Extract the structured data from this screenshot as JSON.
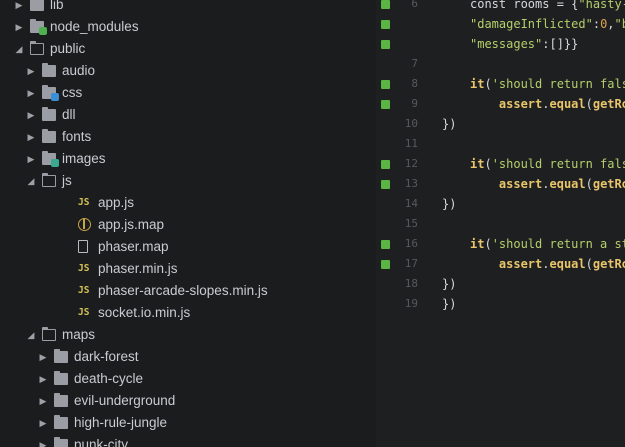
{
  "sidebar": {
    "items": [
      {
        "label": "lib",
        "type": "folder",
        "state": "collapsed",
        "depth": 0
      },
      {
        "label": "node_modules",
        "type": "folder-badged",
        "state": "collapsed",
        "depth": 0,
        "badge_color": "#4fb04f"
      },
      {
        "label": "public",
        "type": "folder",
        "state": "expanded",
        "depth": 0
      },
      {
        "label": "audio",
        "type": "folder",
        "state": "collapsed",
        "depth": 1
      },
      {
        "label": "css",
        "type": "folder-badged",
        "state": "collapsed",
        "depth": 1,
        "badge_color": "#3b8fd6"
      },
      {
        "label": "dll",
        "type": "folder",
        "state": "collapsed",
        "depth": 1
      },
      {
        "label": "fonts",
        "type": "folder",
        "state": "collapsed",
        "depth": 1
      },
      {
        "label": "images",
        "type": "folder-badged",
        "state": "collapsed",
        "depth": 1,
        "badge_color": "#39a98f"
      },
      {
        "label": "js",
        "type": "folder",
        "state": "expanded",
        "depth": 1
      },
      {
        "label": "app.js",
        "type": "js-file",
        "depth": 2,
        "icon_text": "JS"
      },
      {
        "label": "app.js.map",
        "type": "map-file",
        "depth": 2
      },
      {
        "label": "phaser.map",
        "type": "plain-file",
        "depth": 2
      },
      {
        "label": "phaser.min.js",
        "type": "js-file",
        "depth": 2,
        "icon_text": "JS"
      },
      {
        "label": "phaser-arcade-slopes.min.js",
        "type": "js-file",
        "depth": 2,
        "icon_text": "JS"
      },
      {
        "label": "socket.io.min.js",
        "type": "js-file",
        "depth": 2,
        "icon_text": "JS"
      },
      {
        "label": "maps",
        "type": "folder",
        "state": "expanded",
        "depth": 1
      },
      {
        "label": "dark-forest",
        "type": "folder",
        "state": "collapsed",
        "depth": 2
      },
      {
        "label": "death-cycle",
        "type": "folder",
        "state": "collapsed",
        "depth": 2
      },
      {
        "label": "evil-underground",
        "type": "folder",
        "state": "collapsed",
        "depth": 2
      },
      {
        "label": "high-rule-jungle",
        "type": "folder",
        "state": "collapsed",
        "depth": 2
      },
      {
        "label": "punk-city",
        "type": "folder",
        "state": "collapsed",
        "depth": 2
      }
    ]
  },
  "editor": {
    "lines": [
      {
        "num": "6",
        "marked": true,
        "segments": [
          [
            "plain",
            "const rooms = {"
          ],
          [
            "str",
            "\"hasty-"
          ]
        ]
      },
      {
        "num": "",
        "marked": true,
        "segments": [
          [
            "str",
            "\"damageInflicted\""
          ],
          [
            "plain",
            ":"
          ],
          [
            "num",
            "0"
          ],
          [
            "plain",
            ","
          ],
          [
            "str",
            "\"b"
          ]
        ]
      },
      {
        "num": "",
        "marked": true,
        "segments": [
          [
            "str",
            "\"messages\""
          ],
          [
            "plain",
            ":[]}}"
          ]
        ]
      },
      {
        "num": "7",
        "marked": false,
        "segments": []
      },
      {
        "num": "8",
        "marked": true,
        "segments": [
          [
            "kw",
            "it"
          ],
          [
            "plain",
            "("
          ],
          [
            "str",
            "'should return fals"
          ]
        ]
      },
      {
        "num": "9",
        "marked": true,
        "segments": [
          [
            "plain",
            "    "
          ],
          [
            "fn",
            "assert"
          ],
          [
            "plain",
            "."
          ],
          [
            "fn",
            "equal"
          ],
          [
            "plain",
            "("
          ],
          [
            "fn",
            "getRo"
          ]
        ]
      },
      {
        "num": "10",
        "marked": false,
        "segments": [
          [
            "plain",
            "})"
          ]
        ]
      },
      {
        "num": "11",
        "marked": false,
        "segments": []
      },
      {
        "num": "12",
        "marked": true,
        "segments": [
          [
            "kw",
            "it"
          ],
          [
            "plain",
            "("
          ],
          [
            "str",
            "'should return fals"
          ]
        ]
      },
      {
        "num": "13",
        "marked": true,
        "segments": [
          [
            "plain",
            "    "
          ],
          [
            "fn",
            "assert"
          ],
          [
            "plain",
            "."
          ],
          [
            "fn",
            "equal"
          ],
          [
            "plain",
            "("
          ],
          [
            "fn",
            "getRo"
          ]
        ]
      },
      {
        "num": "14",
        "marked": false,
        "segments": [
          [
            "plain",
            "})"
          ]
        ]
      },
      {
        "num": "15",
        "marked": false,
        "segments": []
      },
      {
        "num": "16",
        "marked": true,
        "segments": [
          [
            "kw",
            "it"
          ],
          [
            "plain",
            "("
          ],
          [
            "str",
            "'should return a st"
          ]
        ]
      },
      {
        "num": "17",
        "marked": true,
        "segments": [
          [
            "plain",
            "    "
          ],
          [
            "fn",
            "assert"
          ],
          [
            "plain",
            "."
          ],
          [
            "fn",
            "equal"
          ],
          [
            "plain",
            "("
          ],
          [
            "fn",
            "getRo"
          ]
        ]
      },
      {
        "num": "18",
        "marked": false,
        "segments": [
          [
            "plain",
            "})"
          ]
        ]
      },
      {
        "num": "19",
        "marked": false,
        "segments": [
          [
            "plain",
            "})"
          ]
        ]
      }
    ]
  }
}
